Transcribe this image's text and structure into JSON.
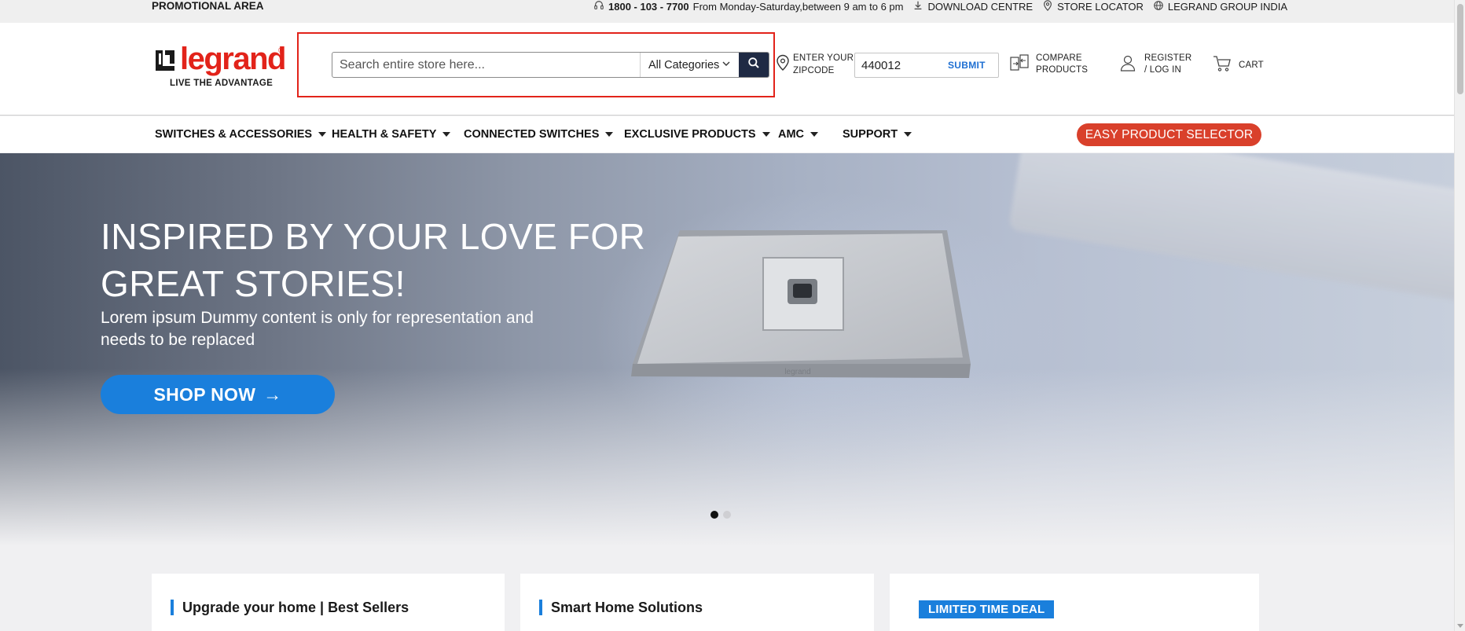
{
  "topbar": {
    "promo": "PROMOTIONAL AREA",
    "phone": "1800 - 103 - 7700",
    "hours": "From Monday-Saturday,between 9 am to 6 pm",
    "download": "DOWNLOAD CENTRE",
    "store_locator": "STORE LOCATOR",
    "group": "LEGRAND GROUP INDIA"
  },
  "brand": {
    "name": "legrand",
    "tagline": "LIVE THE ADVANTAGE",
    "color": "#e2231a"
  },
  "search": {
    "placeholder": "Search entire store here...",
    "category": "All Categories"
  },
  "zipcode": {
    "label_line1": "ENTER YOUR",
    "label_line2": "ZIPCODE",
    "value": "440012",
    "submit": "SUBMIT"
  },
  "header_links": {
    "compare_line1": "COMPARE",
    "compare_line2": "PRODUCTS",
    "register_line1": "REGISTER",
    "register_line2": "/ LOG IN",
    "cart": "CART"
  },
  "nav": {
    "items": [
      {
        "label": "SWITCHES & ACCESSORIES"
      },
      {
        "label": "HEALTH & SAFETY"
      },
      {
        "label": "CONNECTED SWITCHES"
      },
      {
        "label": "EXCLUSIVE PRODUCTS"
      },
      {
        "label": "AMC"
      },
      {
        "label": "SUPPORT"
      }
    ],
    "cta": "EASY PRODUCT SELECTOR"
  },
  "hero": {
    "title_line1": "INSPIRED BY YOUR LOVE FOR",
    "title_line2": "GREAT STORIES!",
    "subtitle": "Lorem ipsum Dummy content is only for representation and needs to be replaced",
    "button": "SHOP NOW",
    "button_arrow": "→",
    "slides": 2,
    "active_slide": 1
  },
  "cards": {
    "best_sellers": "Upgrade your home | Best Sellers",
    "smart_home": "Smart Home Solutions",
    "deal_badge": "LIMITED TIME DEAL"
  },
  "colors": {
    "accent_blue": "#1a7fdc",
    "search_button": "#1f2a44",
    "cta_red": "#d9402b"
  }
}
